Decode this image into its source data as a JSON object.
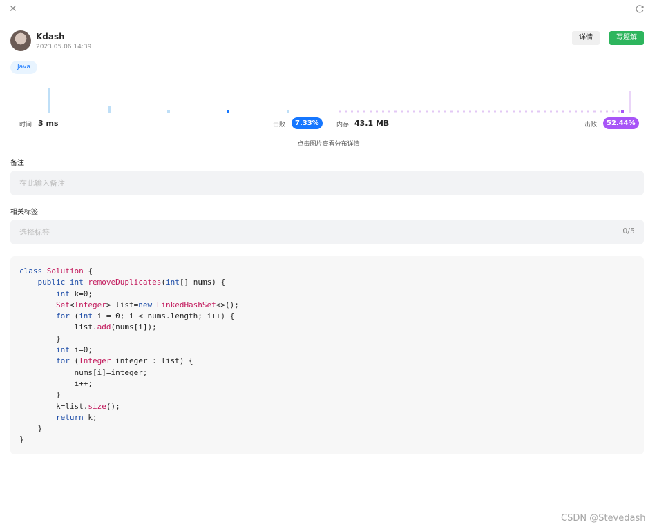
{
  "submission": {
    "username": "Kdash",
    "timestamp": "2023.05.06 14:39",
    "detail_label": "详情",
    "write_solution_label": "写题解",
    "language": "Java"
  },
  "stats": {
    "time_label": "时间",
    "time_value": "3 ms",
    "time_beat_label": "击败",
    "time_beat_value": "7.33%",
    "memory_label": "内存",
    "memory_value": "43.1 MB",
    "memory_beat_label": "击败",
    "memory_beat_value": "52.44%",
    "hint": "点击图片查看分布详情"
  },
  "notes": {
    "title": "备注",
    "placeholder": "在此输入备注"
  },
  "tags": {
    "title": "相关标签",
    "placeholder": "选择标签",
    "counter": "0/5"
  },
  "code": [
    "class Solution {",
    "    public int removeDuplicates(int[] nums) {",
    "        int k=0;",
    "        Set<Integer> list=new LinkedHashSet<>();",
    "        for (int i = 0; i < nums.length; i++) {",
    "            list.add(nums[i]);",
    "        }",
    "        int i=0;",
    "        for (Integer integer : list) {",
    "            nums[i]=integer;",
    "            i++;",
    "        }",
    "        k=list.size();",
    "        return k;",
    "    }",
    "}"
  ],
  "colors": {
    "time_badge": "#1677ff",
    "memory_badge": "#a855f7",
    "write_button": "#2db55d"
  },
  "watermark": "CSDN @Stevedash"
}
